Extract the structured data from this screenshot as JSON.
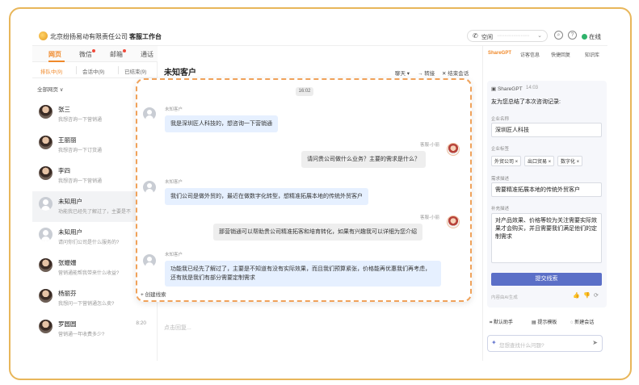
{
  "header": {
    "company": "北京纷扬易动有限责任公司",
    "workspace": "客服工作台",
    "phone_label": "空闲",
    "phone_number": "······················",
    "status": "在线"
  },
  "left": {
    "tabs": [
      {
        "label": "网页"
      },
      {
        "label": "微信"
      },
      {
        "label": "邮箱"
      },
      {
        "label": "通话"
      }
    ],
    "subtabs": [
      {
        "label": "排队中(9)"
      },
      {
        "label": "会话中(9)"
      },
      {
        "label": "已结束(9)"
      }
    ],
    "filter": "全部网页 ∨",
    "contacts": [
      {
        "name": "张三",
        "snippet": "我想咨询一下营销通",
        "time": ""
      },
      {
        "name": "王丽丽",
        "snippet": "我想咨询一下订货通",
        "time": ""
      },
      {
        "name": "李四",
        "snippet": "我想咨询一下营销通",
        "time": ""
      },
      {
        "name": "未知用户",
        "snippet": "功能我已经先了解过了，主要是不",
        "time": ""
      },
      {
        "name": "未知用户",
        "snippet": "请问你们公司是什么服务的?",
        "time": ""
      },
      {
        "name": "张姗姗",
        "snippet": "营销通能帮我带来什么收益?",
        "time": ""
      },
      {
        "name": "杨丽芬",
        "snippet": "我想问一下营销通怎么卖?",
        "time": ""
      },
      {
        "name": "罗圆圆",
        "snippet": "营销通一年收费多少?",
        "time": "8:20"
      }
    ]
  },
  "center": {
    "title": "未知客户",
    "actions": {
      "chat": "聊天 ▾",
      "transfer": "→ 转接",
      "end": "✕ 结束会话"
    },
    "composer_placeholder": "点击回复..."
  },
  "chat": {
    "timestamp": "16:02",
    "new_lead": "+ 创建线索",
    "messages": [
      {
        "sender": "未知客户",
        "text": "我是深圳匠人科技的，想咨询一下营销通"
      },
      {
        "sender": "客服-小丽",
        "text": "请问贵公司做什么业务？主要的需求是什么？"
      },
      {
        "sender": "未知客户",
        "text": "我们公司是做外贸的，最近在做数字化转型，想精准拓展本地的传统外贸客户"
      },
      {
        "sender": "客服-小丽",
        "text": "那营销通可以帮助贵公司精准拓客和培育转化，如果有兴趣我可以详细为您介绍"
      },
      {
        "sender": "未知客户",
        "text": "功能我已经先了解过了，主要是不知道有没有实际效果，而且我们预算紧张，价格能再优惠我们再考虑，还有就是我们有部分需要定制需求"
      }
    ]
  },
  "right": {
    "tabs": [
      {
        "label": "ShareGPT"
      },
      {
        "label": "访客信息"
      },
      {
        "label": "快捷回复"
      },
      {
        "label": "知识库"
      }
    ],
    "bot_name": "ShareGPT",
    "bot_time": "14:03",
    "summary": "友为您总结了本次咨询记录:",
    "fields": {
      "company_label": "企业名称",
      "company_value": "深圳匠人科技",
      "tags_label": "企业标签",
      "tags": [
        "外贸公司 ×",
        "出口贸易 ×",
        "数字化 ×"
      ],
      "need_label": "需求描述",
      "need_value": "需要精准拓展本地的传统外贸客户",
      "extra_label": "补充描述",
      "extra_value": "对产品效果、价格等较为关注需要实际效果才会购买，并且需要我们满足他们的定制需求"
    },
    "submit": "提交线索",
    "ai_note": "内容由AI生成",
    "bottom": {
      "assistant": "默认助手",
      "template": "提示模板",
      "new_chat": "新建会话"
    },
    "input_placeholder": "您想查找什么问题?"
  }
}
